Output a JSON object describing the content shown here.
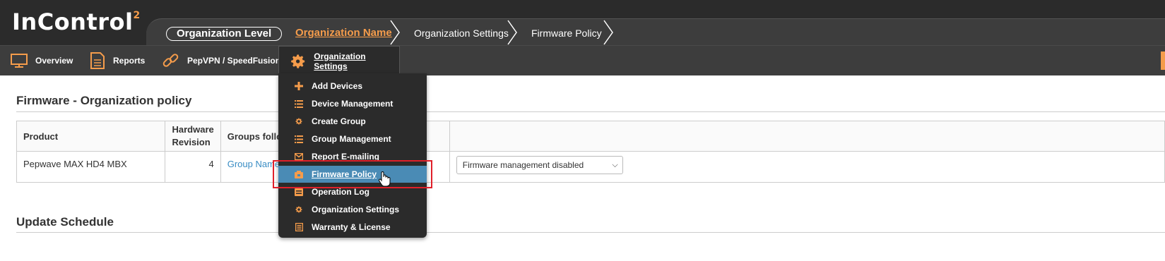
{
  "app": {
    "logo_text": "InControl",
    "logo_sup": "2"
  },
  "breadcrumb": {
    "level": "Organization Level",
    "org_name": "Organization Name",
    "settings": "Organization Settings",
    "page": "Firmware Policy"
  },
  "nav": {
    "overview": "Overview",
    "reports": "Reports",
    "pepvpn": "PepVPN / SpeedFusion",
    "org_settings": "Organization Settings"
  },
  "section": {
    "title": "Firmware - Organization policy"
  },
  "table": {
    "headers": {
      "product": "Product",
      "hw_rev_1": "Hardware",
      "hw_rev_2": "Revision",
      "groups": "Groups follo"
    },
    "row": {
      "product": "Pepwave MAX HD4 MBX",
      "revision": "4",
      "group": "Group Name",
      "policy": "Firmware management disabled"
    }
  },
  "schedule": {
    "title": "Update Schedule"
  },
  "dropdown": {
    "items": [
      {
        "label": "Add Devices",
        "icon": "plus-icon"
      },
      {
        "label": "Device Management",
        "icon": "list-icon"
      },
      {
        "label": "Create Group",
        "icon": "gear-icon"
      },
      {
        "label": "Group Management",
        "icon": "list-icon"
      },
      {
        "label": "Report E-mailing",
        "icon": "envelope-icon"
      },
      {
        "label": "Firmware Policy",
        "icon": "firmware-icon"
      },
      {
        "label": "Operation Log",
        "icon": "log-icon"
      },
      {
        "label": "Organization Settings",
        "icon": "gear-icon"
      },
      {
        "label": "Warranty & License",
        "icon": "document-icon"
      }
    ],
    "highlighted_index": 5
  },
  "colors": {
    "accent": "#f59c4b",
    "highlight": "#4a8bb5",
    "callout": "#e0202a",
    "link": "#3a8dc4"
  }
}
